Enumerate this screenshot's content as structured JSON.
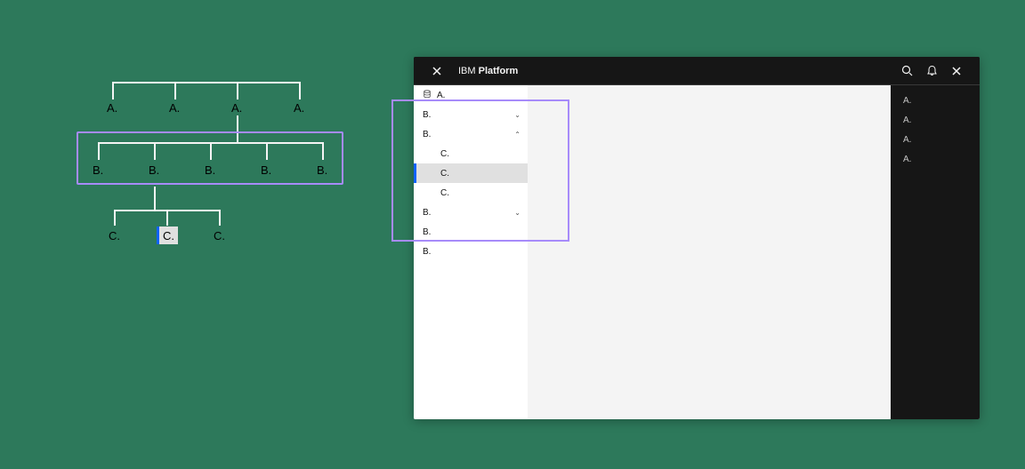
{
  "diagram": {
    "level_a": [
      "A.",
      "A.",
      "A.",
      "A."
    ],
    "level_b": [
      "B.",
      "B.",
      "B.",
      "B.",
      "B."
    ],
    "level_c": [
      "C.",
      "C.",
      "C."
    ],
    "selected_c_index": 1
  },
  "app": {
    "brand_prefix": "IBM",
    "brand_name": "Platform",
    "sidebar_left": [
      {
        "label": "A.",
        "icon": "db",
        "indent": 0,
        "expand": null,
        "selected": false
      },
      {
        "label": "B.",
        "icon": null,
        "indent": 0,
        "expand": "down",
        "selected": false
      },
      {
        "label": "B.",
        "icon": null,
        "indent": 0,
        "expand": "up",
        "selected": false
      },
      {
        "label": "C.",
        "icon": null,
        "indent": 2,
        "expand": null,
        "selected": false
      },
      {
        "label": "C.",
        "icon": null,
        "indent": 2,
        "expand": null,
        "selected": true
      },
      {
        "label": "C.",
        "icon": null,
        "indent": 2,
        "expand": null,
        "selected": false
      },
      {
        "label": "B.",
        "icon": null,
        "indent": 0,
        "expand": "down",
        "selected": false
      },
      {
        "label": "B.",
        "icon": null,
        "indent": 0,
        "expand": null,
        "selected": false
      },
      {
        "label": "B.",
        "icon": null,
        "indent": 0,
        "expand": null,
        "selected": false
      }
    ],
    "sidebar_right": [
      "A.",
      "A.",
      "A.",
      "A."
    ],
    "icons": {
      "close": "close-icon",
      "search": "search-icon",
      "bell": "bell-icon"
    }
  },
  "colors": {
    "accent": "#0f62fe",
    "highlight_border": "#a78bfa",
    "bg": "#2d795b"
  }
}
